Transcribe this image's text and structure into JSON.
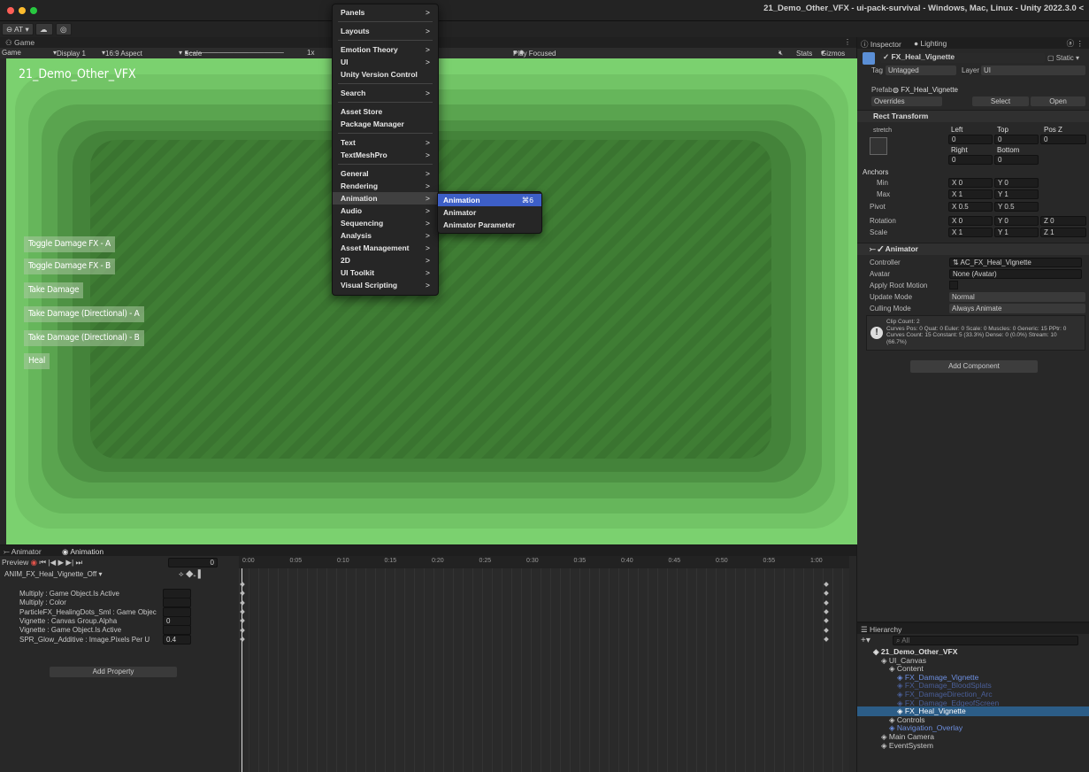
{
  "window": {
    "title": "21_Demo_Other_VFX - ui-pack-survival - Windows, Mac, Linux - Unity 2022.3.0 <",
    "account": "AT"
  },
  "game": {
    "tab": "Game",
    "mode": "Game",
    "display": "Display 1",
    "aspect": "16:9 Aspect",
    "scale_label": "Scale",
    "scale_value": "1x",
    "play_focused": "Play Focused",
    "stats": "Stats",
    "gizmos": "Gizmos",
    "scene_title": "21_Demo_Other_VFX",
    "buttons": [
      "Toggle Damage FX - A",
      "Toggle Damage FX - B",
      "Take Damage",
      "Take Damage (Directional) - A",
      "Take Damage (Directional) - B",
      "Heal"
    ],
    "vignette_color": "#7bd16f"
  },
  "menu": {
    "items": [
      {
        "label": "Panels",
        "arrow": ">"
      },
      {
        "label": "Layouts",
        "arrow": ">"
      },
      {
        "label": "Emotion Theory",
        "arrow": ">"
      },
      {
        "label": "UI",
        "arrow": ">"
      },
      {
        "label": "Unity Version Control",
        "arrow": ""
      },
      {
        "label": "Search",
        "arrow": ">"
      },
      {
        "label": "Asset Store",
        "arrow": ""
      },
      {
        "label": "Package Manager",
        "arrow": ""
      },
      {
        "label": "Text",
        "arrow": ">"
      },
      {
        "label": "TextMeshPro",
        "arrow": ">"
      },
      {
        "label": "General",
        "arrow": ">"
      },
      {
        "label": "Rendering",
        "arrow": ">"
      },
      {
        "label": "Animation",
        "arrow": ">"
      },
      {
        "label": "Audio",
        "arrow": ">"
      },
      {
        "label": "Sequencing",
        "arrow": ">"
      },
      {
        "label": "Analysis",
        "arrow": ">"
      },
      {
        "label": "Asset Management",
        "arrow": ">"
      },
      {
        "label": "2D",
        "arrow": ">"
      },
      {
        "label": "UI Toolkit",
        "arrow": ">"
      },
      {
        "label": "Visual Scripting",
        "arrow": ">"
      }
    ],
    "submenu": [
      {
        "label": "Animation",
        "shortcut": "⌘6"
      },
      {
        "label": "Animator",
        "shortcut": ""
      },
      {
        "label": "Animator Parameter",
        "shortcut": ""
      }
    ]
  },
  "inspector": {
    "tab_inspector": "Inspector",
    "tab_lighting": "Lighting",
    "object_name": "FX_Heal_Vignette",
    "static": "Static",
    "tag_label": "Tag",
    "tag": "Untagged",
    "layer_label": "Layer",
    "layer": "UI",
    "prefab_label": "Prefab",
    "prefab": "FX_Heal_Vignette",
    "overrides": "Overrides",
    "select": "Select",
    "open": "Open",
    "rect_transform": "Rect Transform",
    "stretch": "stretch",
    "left_label": "Left",
    "top_label": "Top",
    "posz_label": "Pos Z",
    "left": "0",
    "top": "0",
    "posz": "0",
    "right_label": "Right",
    "bottom_label": "Bottom",
    "right": "0",
    "bottom": "0",
    "anchors": "Anchors",
    "min": "Min",
    "max": "Max",
    "min_x": "0",
    "min_y": "0",
    "max_x": "1",
    "max_y": "1",
    "pivot": "Pivot",
    "pivot_x": "0.5",
    "pivot_y": "0.5",
    "rotation": "Rotation",
    "rot_x": "0",
    "rot_y": "0",
    "rot_z": "0",
    "scale": "Scale",
    "scale_x": "1",
    "scale_y": "1",
    "scale_z": "1",
    "animator": "Animator",
    "controller_label": "Controller",
    "controller": "AC_FX_Heal_Vignette",
    "avatar_label": "Avatar",
    "avatar": "None (Avatar)",
    "apply_root": "Apply Root Motion",
    "update_label": "Update Mode",
    "update": "Normal",
    "culling_label": "Culling Mode",
    "culling": "Always Animate",
    "info": [
      "Clip Count: 2",
      "Curves Pos: 0 Quat: 0 Euler: 0 Scale: 0 Muscles: 0 Generic: 15 PPtr: 0",
      "Curves Count: 15 Constant: 5 (33.3%) Dense: 0 (0.0%) Stream: 10",
      "(66.7%)"
    ],
    "add_component": "Add Component"
  },
  "hierarchy": {
    "title": "Hierarchy",
    "search": "All",
    "items": [
      {
        "label": "21_Demo_Other_VFX",
        "indent": 0,
        "color": "#e0e0e0",
        "bold": true
      },
      {
        "label": "UI_Canvas",
        "indent": 1,
        "color": "#c8c8c8"
      },
      {
        "label": "Content",
        "indent": 2,
        "color": "#c8c8c8"
      },
      {
        "label": "FX_Damage_Vignette",
        "indent": 3,
        "color": "#6d8fe0"
      },
      {
        "label": "FX_Damage_BloodSplats",
        "indent": 3,
        "color": "#4a5f99"
      },
      {
        "label": "FX_DamageDirection_Arc",
        "indent": 3,
        "color": "#4a5f99"
      },
      {
        "label": "FX_Damage_EdgeofScreen",
        "indent": 3,
        "color": "#4a5f99"
      },
      {
        "label": "FX_Heal_Vignette",
        "indent": 3,
        "color": "#ffffff",
        "selected": true
      },
      {
        "label": "Controls",
        "indent": 2,
        "color": "#c8c8c8"
      },
      {
        "label": "Navigation_Overlay",
        "indent": 2,
        "color": "#6d8fe0"
      },
      {
        "label": "Main Camera",
        "indent": 1,
        "color": "#c8c8c8"
      },
      {
        "label": "EventSystem",
        "indent": 1,
        "color": "#c8c8c8"
      }
    ]
  },
  "animation": {
    "tab_animator": "Animator",
    "tab_animation": "Animation",
    "preview": "Preview",
    "frame": "0",
    "clip": "ANIM_FX_Heal_Vignette_Off",
    "ticks": [
      "0:00",
      "0:05",
      "0:10",
      "0:15",
      "0:20",
      "0:25",
      "0:30",
      "0:35",
      "0:40",
      "0:45",
      "0:50",
      "0:55",
      "1:00"
    ],
    "properties": [
      {
        "label": "Multiply : Game Object.Is Active",
        "value": ""
      },
      {
        "label": "Multiply : Color",
        "value": ""
      },
      {
        "label": "ParticleFX_HealingDots_Sml : Game Objec",
        "value": ""
      },
      {
        "label": "Vignette : Canvas Group.Alpha",
        "value": "0"
      },
      {
        "label": "Vignette : Game Object.Is Active",
        "value": ""
      },
      {
        "label": "SPR_Glow_Additive : Image.Pixels Per U",
        "value": "0.4"
      }
    ],
    "add_property": "Add Property"
  }
}
